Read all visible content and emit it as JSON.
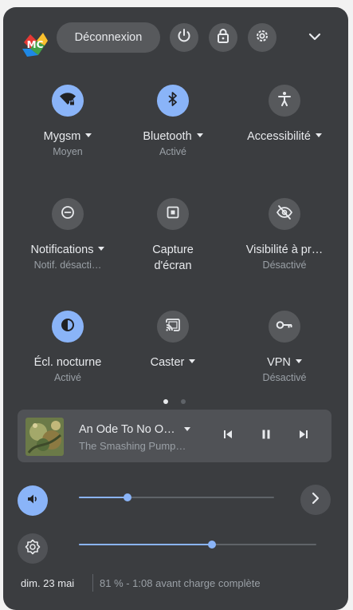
{
  "header": {
    "signout_label": "Déconnexion",
    "logo_text": "MC"
  },
  "tiles": [
    {
      "label": "Mygsm",
      "sub": "Moyen",
      "icon": "wifi-locked-icon",
      "active": true,
      "has_caret": true
    },
    {
      "label": "Bluetooth",
      "sub": "Activé",
      "icon": "bluetooth-icon",
      "active": true,
      "has_caret": true
    },
    {
      "label": "Accessibilité",
      "sub": "",
      "icon": "accessibility-icon",
      "active": false,
      "has_caret": true
    },
    {
      "label": "Notifications",
      "sub": "Notif. désacti…",
      "icon": "do-not-disturb-icon",
      "active": false,
      "has_caret": true
    },
    {
      "label": "Capture",
      "label2": "d'écran",
      "sub": "",
      "icon": "screen-capture-icon",
      "active": false,
      "has_caret": false
    },
    {
      "label": "Visibilité à pr…",
      "sub": "Désactivé",
      "icon": "visibility-off-icon",
      "active": false,
      "has_caret": false
    },
    {
      "label": "Écl. nocturne",
      "sub": "Activé",
      "icon": "night-light-icon",
      "active": true,
      "has_caret": false
    },
    {
      "label": "Caster",
      "sub": "",
      "icon": "cast-icon",
      "active": false,
      "has_caret": true
    },
    {
      "label": "VPN",
      "sub": "Désactivé",
      "icon": "vpn-key-icon",
      "active": false,
      "has_caret": true
    }
  ],
  "media": {
    "title": "An Ode To No O…",
    "artist": "The Smashing Pump…"
  },
  "sliders": {
    "volume_level": 0.25,
    "brightness_level": 0.56
  },
  "footer": {
    "date": "dim. 23 mai",
    "battery": "81 % - 1:08 avant charge complète"
  },
  "colors": {
    "panel_bg": "#3b3d40",
    "button_bg": "#57595c",
    "accent": "#8ab4f8",
    "text": "#e8eaed",
    "subtext": "#9aa0a6"
  },
  "pager": {
    "current_page": 1,
    "total_pages": 2
  }
}
